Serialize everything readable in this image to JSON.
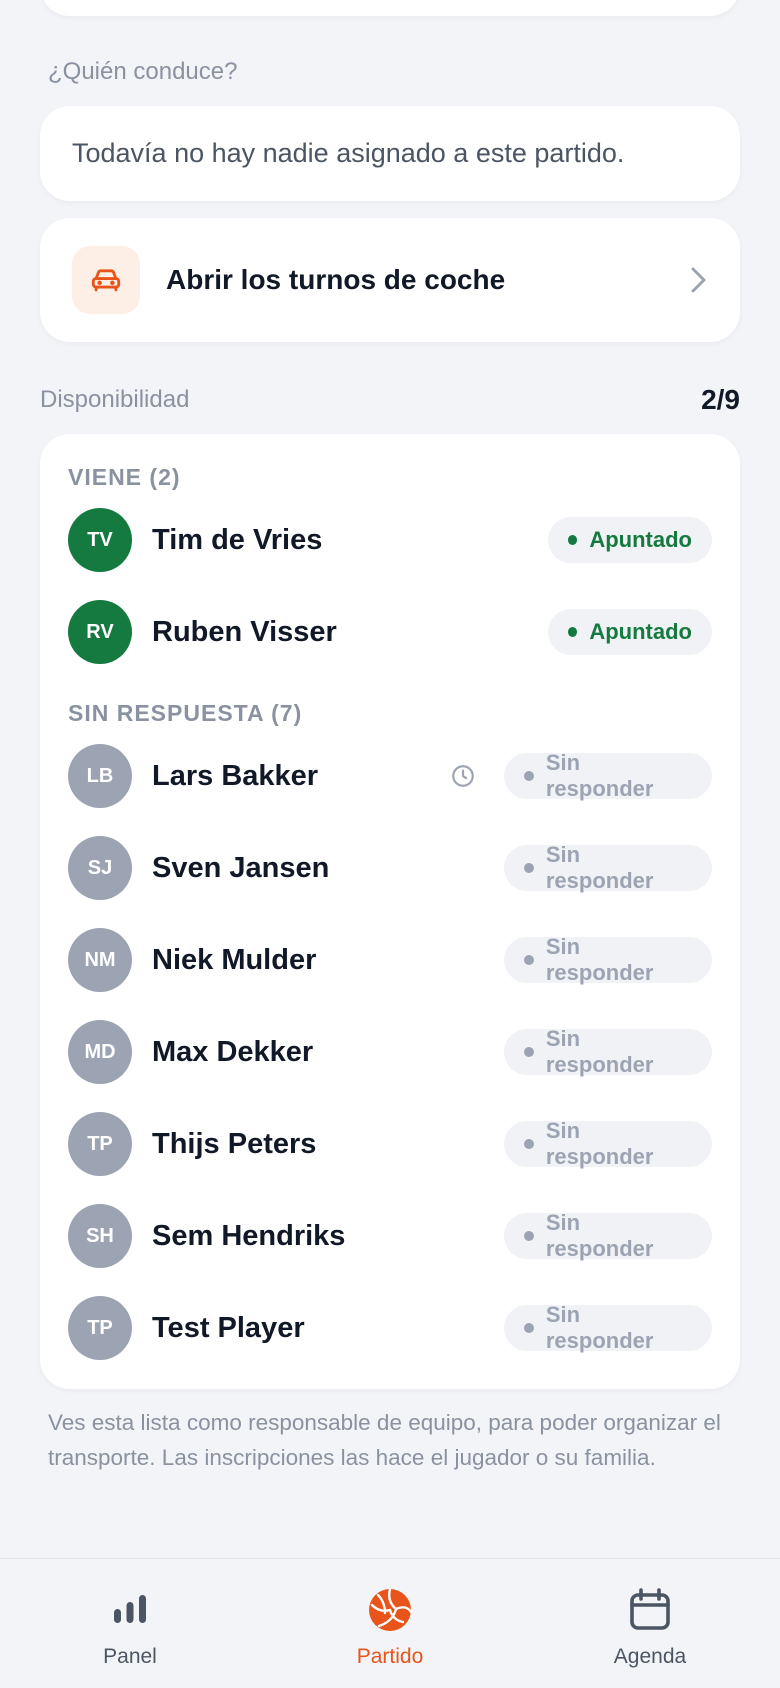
{
  "driver": {
    "section_label": "¿Quién conduce?",
    "empty_text": "Todavía no hay nadie asignado a este partido."
  },
  "carpool": {
    "label": "Abrir los turnos de coche",
    "icon": "car-icon",
    "accent": "#e8541a"
  },
  "availability": {
    "title": "Disponibilidad",
    "count": "2/9",
    "groups": {
      "coming": {
        "label": "VIENE (2)",
        "players": [
          {
            "initials": "TV",
            "name": "Tim de Vries",
            "status": "Apuntado"
          },
          {
            "initials": "RV",
            "name": "Ruben Visser",
            "status": "Apuntado"
          }
        ]
      },
      "no_response": {
        "label": "SIN RESPUESTA (7)",
        "players": [
          {
            "initials": "LB",
            "name": "Lars Bakker",
            "status": "Sin responder",
            "icon": "clock-icon"
          },
          {
            "initials": "SJ",
            "name": "Sven Jansen",
            "status": "Sin responder"
          },
          {
            "initials": "NM",
            "name": "Niek Mulder",
            "status": "Sin responder"
          },
          {
            "initials": "MD",
            "name": "Max Dekker",
            "status": "Sin responder"
          },
          {
            "initials": "TP",
            "name": "Thijs Peters",
            "status": "Sin responder"
          },
          {
            "initials": "SH",
            "name": "Sem Hendriks",
            "status": "Sin responder"
          },
          {
            "initials": "TP",
            "name": "Test Player",
            "status": "Sin responder"
          }
        ]
      }
    },
    "colors": {
      "coming": "#157a3f",
      "no_response": "#9ca3b2"
    }
  },
  "note": "Ves esta lista como responsable de equipo, para poder organizar el transporte. Las inscripciones las hace el jugador o su familia.",
  "tabbar": {
    "tabs": [
      {
        "label": "Panel",
        "icon": "bar-chart-icon"
      },
      {
        "label": "Partido",
        "icon": "volleyball-icon",
        "active": true
      },
      {
        "label": "Agenda",
        "icon": "calendar-icon"
      }
    ]
  }
}
